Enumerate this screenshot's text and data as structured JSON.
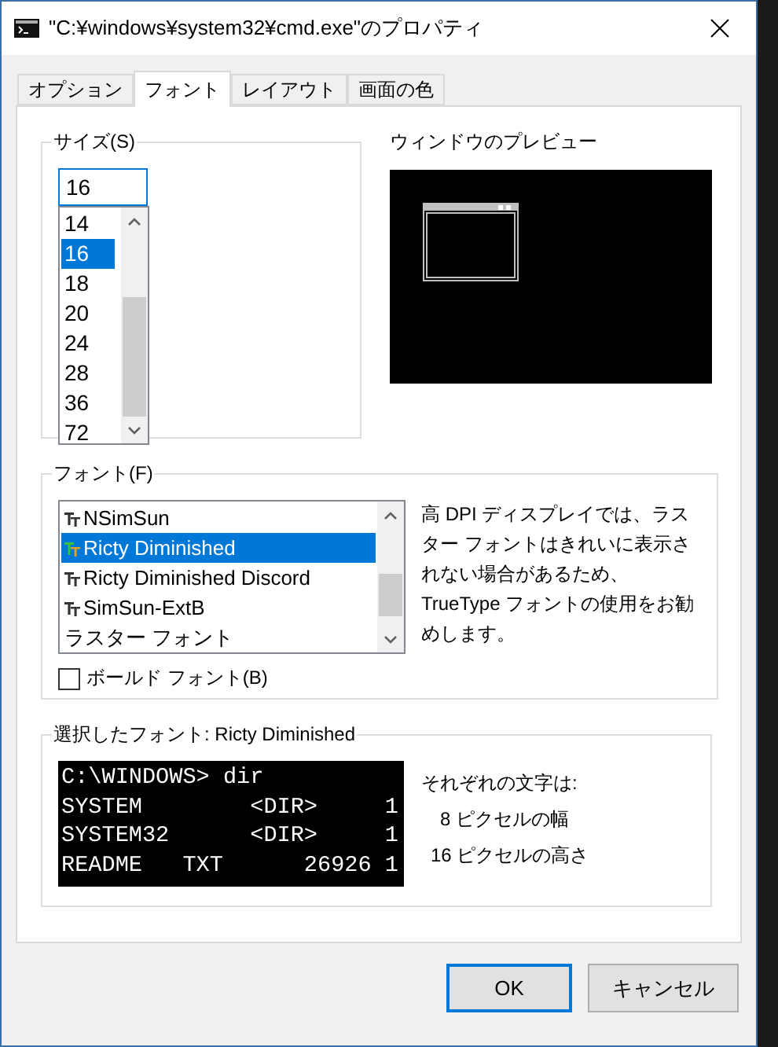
{
  "window": {
    "title": "\"C:¥windows¥system32¥cmd.exe\"のプロパティ"
  },
  "tabs": [
    {
      "label": "オプション",
      "selected": false
    },
    {
      "label": "フォント",
      "selected": true
    },
    {
      "label": "レイアウト",
      "selected": false
    },
    {
      "label": "画面の色",
      "selected": false
    }
  ],
  "size_group": {
    "label": "サイズ(S)",
    "value": "16",
    "items": [
      {
        "label": "14",
        "selected": false
      },
      {
        "label": "16",
        "selected": true
      },
      {
        "label": "18",
        "selected": false
      },
      {
        "label": "20",
        "selected": false
      },
      {
        "label": "24",
        "selected": false
      },
      {
        "label": "28",
        "selected": false
      },
      {
        "label": "36",
        "selected": false
      },
      {
        "label": "72",
        "selected": false
      }
    ]
  },
  "window_preview": {
    "label": "ウィンドウのプレビュー"
  },
  "font_group": {
    "label": "フォント(F)",
    "items": [
      {
        "label": "NSimSun",
        "kind": "truetype",
        "selected": false
      },
      {
        "label": "Ricty Diminished",
        "kind": "truetype",
        "selected": true
      },
      {
        "label": "Ricty Diminished Discord",
        "kind": "truetype",
        "selected": false
      },
      {
        "label": "SimSun-ExtB",
        "kind": "truetype",
        "selected": false
      },
      {
        "label": "ラスター フォント",
        "kind": "raster",
        "selected": false
      }
    ],
    "note": "高 DPI ディスプレイでは、ラスター フォントはきれいに表示されない場合があるため、TrueType フォントの使用をお勧めします。",
    "bold_checkbox": {
      "label": "ボールド フォント(B)",
      "checked": false
    }
  },
  "selected_font": {
    "label": "選択したフォント: Ricty Diminished",
    "preview_lines": [
      "C:\\WINDOWS> dir",
      "SYSTEM        <DIR>     1",
      "SYSTEM32      <DIR>     1",
      "README   TXT      26926 1"
    ],
    "info_title": "それぞれの文字は:",
    "info_lines": [
      "8 ピクセルの幅",
      "16 ピクセルの高さ"
    ]
  },
  "buttons": [
    "OK",
    "キャンセル"
  ]
}
